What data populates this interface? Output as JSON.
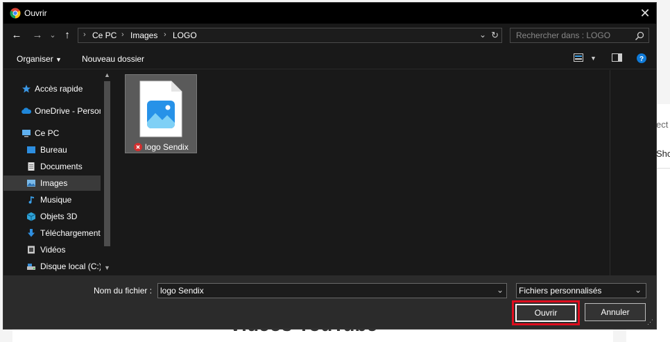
{
  "background": {
    "heading": "Vidéos YouTube",
    "side_text_1": "ect",
    "side_text_2": "Sho"
  },
  "titlebar": {
    "title": "Ouvrir",
    "close_label": "✕"
  },
  "nav": {
    "back": "←",
    "forward": "→",
    "recent": "⌄",
    "up": "↑",
    "breadcrumb": [
      "Ce PC",
      "Images",
      "LOGO"
    ],
    "search_placeholder": "Rechercher dans : LOGO"
  },
  "toolbar": {
    "organize": "Organiser",
    "new_folder": "Nouveau dossier"
  },
  "sidebar": {
    "items": [
      {
        "label": "Accès rapide",
        "icon": "star-icon"
      },
      {
        "label": "OneDrive - Personnel",
        "icon": "cloud-icon"
      },
      {
        "label": "Ce PC",
        "icon": "computer-icon"
      },
      {
        "label": "Bureau",
        "icon": "desktop-icon"
      },
      {
        "label": "Documents",
        "icon": "documents-icon"
      },
      {
        "label": "Images",
        "icon": "images-icon"
      },
      {
        "label": "Musique",
        "icon": "music-icon"
      },
      {
        "label": "Objets 3D",
        "icon": "objects3d-icon"
      },
      {
        "label": "Téléchargements",
        "icon": "download-icon"
      },
      {
        "label": "Vidéos",
        "icon": "videos-icon"
      },
      {
        "label": "Disque local (C:)",
        "icon": "drive-icon"
      }
    ]
  },
  "files": [
    {
      "name": "logo Sendix",
      "status": "error"
    }
  ],
  "bottom": {
    "filename_label": "Nom du fichier :",
    "filename_value": "logo Sendix",
    "filetype_value": "Fichiers personnalisés",
    "open_button": "Ouvrir",
    "cancel_button": "Annuler"
  },
  "colors": {
    "dialog_bg": "#191919",
    "highlight": "#e00d1e",
    "accent_blue": "#0f7ad8"
  }
}
